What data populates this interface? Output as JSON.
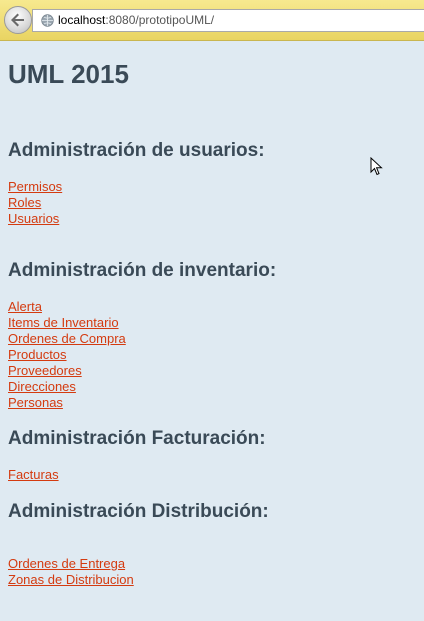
{
  "browser": {
    "url_host": "localhost",
    "url_rest": ":8080/prototipoUML/"
  },
  "page": {
    "title": "UML 2015"
  },
  "sections": [
    {
      "heading": "Administración de usuarios:",
      "links": [
        "Permisos",
        "Roles",
        "Usuarios"
      ]
    },
    {
      "heading": "Administración de inventario:",
      "links": [
        "Alerta",
        "Items de Inventario",
        "Ordenes de Compra",
        "Productos",
        "Proveedores",
        "Direcciones",
        "Personas"
      ]
    },
    {
      "heading": "Administración Facturación:",
      "links": [
        "Facturas"
      ]
    },
    {
      "heading": "Administración Distribución:",
      "links": [
        "Ordenes de Entrega",
        "Zonas de Distribucion"
      ]
    }
  ],
  "colors": {
    "background": "#dfeaf2",
    "heading": "#3a4a57",
    "link": "#d43b10"
  }
}
